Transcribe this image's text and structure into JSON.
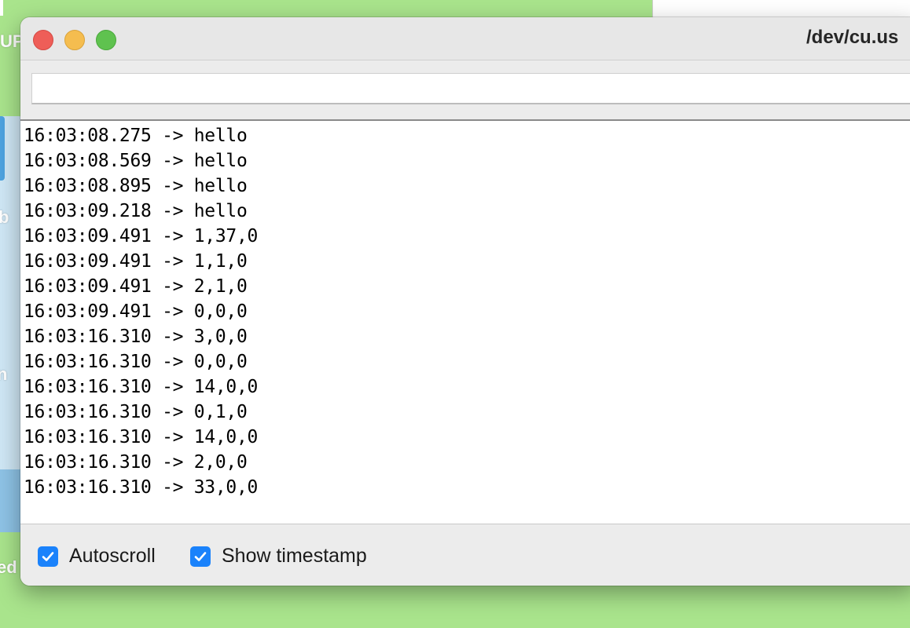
{
  "window": {
    "title": "/dev/cu.us"
  },
  "send": {
    "value": ""
  },
  "log": [
    "16:03:08.275 -> hello",
    "16:03:08.569 -> hello",
    "16:03:08.895 -> hello",
    "16:03:09.218 -> hello",
    "16:03:09.491 -> 1,37,0",
    "16:03:09.491 -> 1,1,0",
    "16:03:09.491 -> 2,1,0",
    "16:03:09.491 -> 0,0,0",
    "16:03:16.310 -> 3,0,0",
    "16:03:16.310 -> 0,0,0",
    "16:03:16.310 -> 14,0,0",
    "16:03:16.310 -> 0,1,0",
    "16:03:16.310 -> 14,0,0",
    "16:03:16.310 -> 2,0,0",
    "16:03:16.310 -> 33,0,0"
  ],
  "footer": {
    "autoscroll": {
      "label": "Autoscroll",
      "checked": true
    },
    "timestamp": {
      "label": "Show timestamp",
      "checked": true
    }
  },
  "background": {
    "edge_texts": [
      "UP",
      "b",
      "n",
      "ed"
    ]
  },
  "colors": {
    "desktop": "#a9e48c",
    "checkbox": "#1a82fb",
    "close": "#ee5e58",
    "minimize": "#f5bd4f",
    "maximize": "#5fc24f"
  },
  "icons": {
    "checkbox": "checkmark-icon"
  }
}
